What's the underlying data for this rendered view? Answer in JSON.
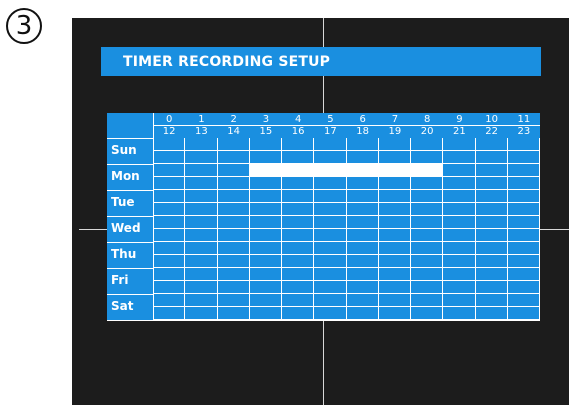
{
  "step_number": "3",
  "title": "TIMER RECORDING SETUP",
  "hours_top": [
    "0",
    "1",
    "2",
    "3",
    "4",
    "5",
    "6",
    "7",
    "8",
    "9",
    "10",
    "11"
  ],
  "hours_bottom": [
    "12",
    "13",
    "14",
    "15",
    "16",
    "17",
    "18",
    "19",
    "20",
    "21",
    "22",
    "23"
  ],
  "days": [
    "Sun",
    "Mon",
    "Tue",
    "Wed",
    "Thu",
    "Fri",
    "Sat"
  ],
  "schedule": {
    "Mon": {
      "row": 1,
      "active_columns": [
        3,
        4,
        5,
        6,
        7,
        8
      ],
      "sub_row": "top"
    }
  },
  "colors": {
    "screen_bg": "#1c1c1c",
    "accent": "#1a8fe0",
    "grid_line": "#ffffff",
    "active_cell": "#ffffff"
  }
}
